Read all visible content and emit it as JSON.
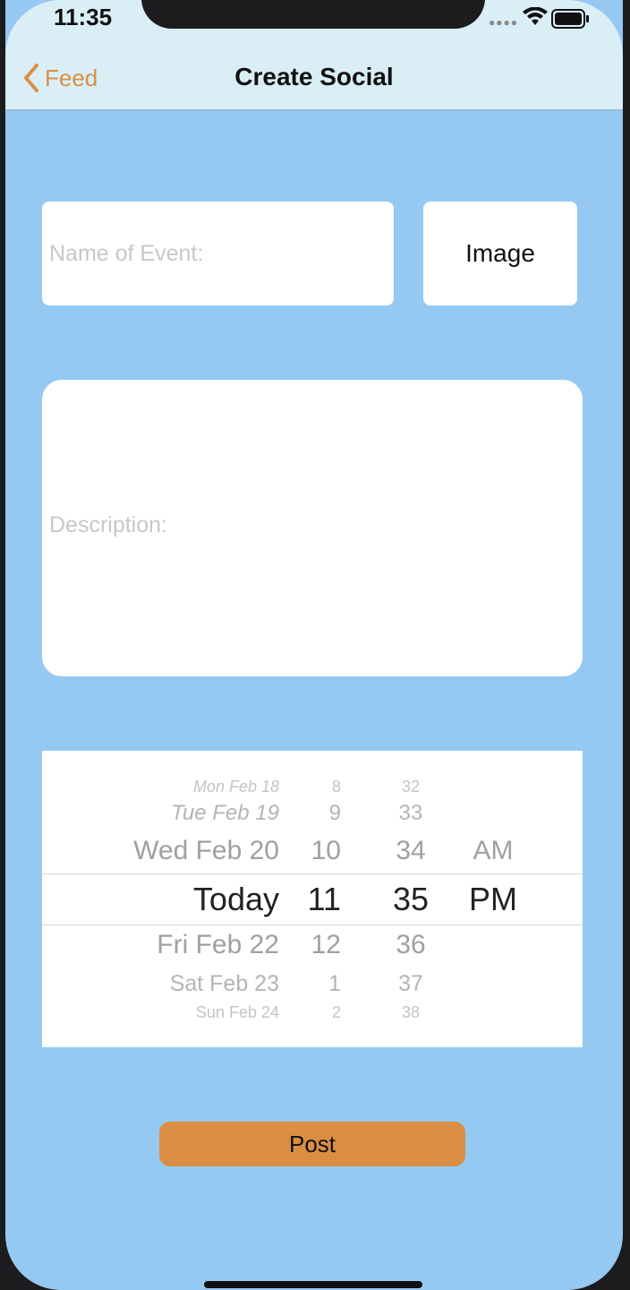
{
  "status_bar": {
    "time": "11:35",
    "signal_icon": "signal-dots-icon",
    "wifi_icon": "wifi-icon",
    "battery_icon": "battery-icon"
  },
  "nav": {
    "back_label": "Feed",
    "back_icon": "chevron-left-icon",
    "title": "Create Social"
  },
  "form": {
    "name_placeholder": "Name of Event:",
    "image_label": "Image",
    "description_placeholder": "Description:",
    "post_label": "Post"
  },
  "date_picker": {
    "dates": [
      "Mon Feb 18",
      "Tue Feb 19",
      "Wed Feb 20",
      "Today",
      "Fri Feb 22",
      "Sat Feb 23",
      "Sun Feb 24"
    ],
    "hours": [
      "8",
      "9",
      "10",
      "11",
      "12",
      "1",
      "2"
    ],
    "minutes": [
      "32",
      "33",
      "34",
      "35",
      "36",
      "37",
      "38"
    ],
    "ampm": [
      "AM",
      "PM"
    ],
    "selected": {
      "date": "Today",
      "hour": "11",
      "minute": "35",
      "ampm": "PM"
    }
  },
  "colors": {
    "background": "#96c9f2",
    "nav_bar": "#daeef6",
    "accent": "#d98e44"
  }
}
